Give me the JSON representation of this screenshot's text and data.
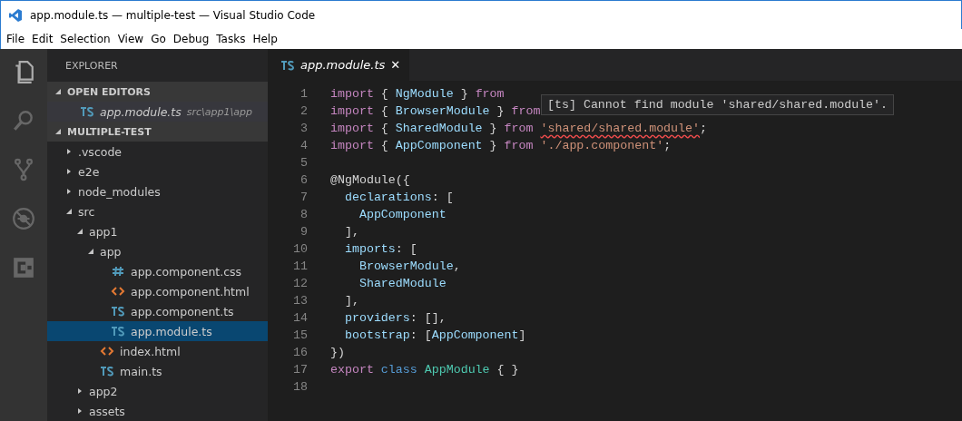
{
  "window": {
    "title": "app.module.ts — multiple-test — Visual Studio Code"
  },
  "menu": [
    "File",
    "Edit",
    "Selection",
    "View",
    "Go",
    "Debug",
    "Tasks",
    "Help"
  ],
  "activity_bar": [
    {
      "kind": "files",
      "selected": true
    },
    {
      "kind": "search",
      "selected": false
    },
    {
      "kind": "git",
      "selected": false
    },
    {
      "kind": "debug",
      "selected": false
    },
    {
      "kind": "extensions",
      "selected": false
    }
  ],
  "sidebar": {
    "title": "EXPLORER",
    "open_editors": {
      "title": "OPEN EDITORS",
      "expanded": true,
      "items": [
        {
          "kind": "ts",
          "label": "app.module.ts",
          "path": "src\\app1\\app"
        }
      ]
    },
    "project": {
      "title": "MULTIPLE-TEST",
      "expanded": true,
      "items": [
        {
          "kind": "folder",
          "label": ".vscode",
          "expanded": false,
          "selected": false
        },
        {
          "kind": "folder",
          "label": "e2e",
          "expanded": false,
          "selected": false
        },
        {
          "kind": "folder",
          "label": "node_modules",
          "expanded": false,
          "selected": false
        },
        {
          "kind": "folder",
          "label": "src",
          "expanded": true,
          "selected": false,
          "children": [
            {
              "kind": "folder",
              "label": "app1",
              "expanded": true,
              "selected": false,
              "children": [
                {
                  "kind": "folder",
                  "label": "app",
                  "expanded": true,
                  "selected": false,
                  "children": [
                    {
                      "kind": "css",
                      "label": "app.component.css",
                      "selected": false
                    },
                    {
                      "kind": "html",
                      "label": "app.component.html",
                      "selected": false
                    },
                    {
                      "kind": "ts",
                      "label": "app.component.ts",
                      "selected": false
                    },
                    {
                      "kind": "ts",
                      "label": "app.module.ts",
                      "selected": true
                    }
                  ]
                },
                {
                  "kind": "html",
                  "label": "index.html",
                  "selected": false
                },
                {
                  "kind": "ts",
                  "label": "main.ts",
                  "selected": false
                }
              ]
            },
            {
              "kind": "folder",
              "label": "app2",
              "expanded": false,
              "selected": false
            },
            {
              "kind": "folder",
              "label": "assets",
              "expanded": false,
              "selected": false
            }
          ]
        }
      ]
    }
  },
  "editor": {
    "tabs": [
      {
        "kind": "ts",
        "label": "app.module.ts",
        "selected": true,
        "close": "✕"
      }
    ],
    "lines": [
      {
        "number": "1",
        "tokens": [
          {
            "kind": "keyword",
            "text": "import"
          },
          {
            "kind": "punct",
            "text": " { "
          },
          {
            "kind": "ident",
            "text": "NgModule"
          },
          {
            "kind": "punct",
            "text": " } "
          },
          {
            "kind": "keyword",
            "text": "from"
          }
        ]
      },
      {
        "number": "2",
        "tokens": [
          {
            "kind": "keyword",
            "text": "import"
          },
          {
            "kind": "punct",
            "text": " { "
          },
          {
            "kind": "ident",
            "text": "BrowserModule"
          },
          {
            "kind": "punct",
            "text": " } "
          },
          {
            "kind": "keyword",
            "text": "from"
          }
        ]
      },
      {
        "number": "3",
        "tokens": [
          {
            "kind": "keyword",
            "text": "import"
          },
          {
            "kind": "punct",
            "text": " { "
          },
          {
            "kind": "ident",
            "text": "SharedModule"
          },
          {
            "kind": "punct",
            "text": " } "
          },
          {
            "kind": "keyword",
            "text": "from "
          },
          {
            "kind": "string",
            "text": "'shared/shared.module'",
            "error": true
          },
          {
            "kind": "punct",
            "text": ";"
          }
        ]
      },
      {
        "number": "4",
        "tokens": [
          {
            "kind": "keyword",
            "text": "import"
          },
          {
            "kind": "punct",
            "text": " { "
          },
          {
            "kind": "ident",
            "text": "AppComponent"
          },
          {
            "kind": "punct",
            "text": " } "
          },
          {
            "kind": "keyword",
            "text": "from "
          },
          {
            "kind": "string",
            "text": "'./app.component'"
          },
          {
            "kind": "punct",
            "text": ";"
          }
        ]
      },
      {
        "number": "5"
      },
      {
        "number": "6",
        "tokens": [
          {
            "kind": "punct",
            "text": "@NgModule({"
          }
        ]
      },
      {
        "number": "7",
        "tokens": [
          {
            "kind": "ident",
            "text": "  declarations"
          },
          {
            "kind": "punct",
            "text": ": ["
          }
        ]
      },
      {
        "number": "8",
        "tokens": [
          {
            "kind": "ident",
            "text": "    AppComponent"
          }
        ]
      },
      {
        "number": "9",
        "tokens": [
          {
            "kind": "punct",
            "text": "  ],"
          }
        ]
      },
      {
        "number": "10",
        "tokens": [
          {
            "kind": "ident",
            "text": "  imports"
          },
          {
            "kind": "punct",
            "text": ": ["
          }
        ]
      },
      {
        "number": "11",
        "tokens": [
          {
            "kind": "ident",
            "text": "    BrowserModule"
          },
          {
            "kind": "punct",
            "text": ","
          }
        ]
      },
      {
        "number": "12",
        "tokens": [
          {
            "kind": "ident",
            "text": "    SharedModule"
          }
        ]
      },
      {
        "number": "13",
        "tokens": [
          {
            "kind": "punct",
            "text": "  ],"
          }
        ]
      },
      {
        "number": "14",
        "tokens": [
          {
            "kind": "ident",
            "text": "  providers"
          },
          {
            "kind": "punct",
            "text": ": [],"
          }
        ]
      },
      {
        "number": "15",
        "tokens": [
          {
            "kind": "ident",
            "text": "  bootstrap"
          },
          {
            "kind": "punct",
            "text": ": ["
          },
          {
            "kind": "ident",
            "text": "AppComponent"
          },
          {
            "kind": "punct",
            "text": "]"
          }
        ]
      },
      {
        "number": "16",
        "tokens": [
          {
            "kind": "punct",
            "text": "})"
          }
        ]
      },
      {
        "number": "17",
        "tokens": [
          {
            "kind": "keyword",
            "text": "export "
          },
          {
            "kind": "storage",
            "text": "class "
          },
          {
            "kind": "type",
            "text": "AppModule"
          },
          {
            "kind": "punct",
            "text": " { }"
          }
        ]
      },
      {
        "number": "18"
      }
    ],
    "tooltip": "[ts] Cannot find module 'shared/shared.module'."
  }
}
